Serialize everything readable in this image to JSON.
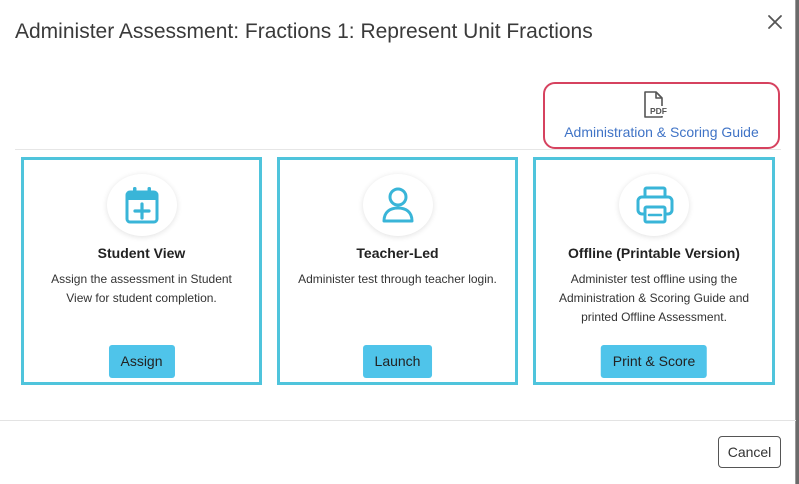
{
  "dialog": {
    "title": "Administer Assessment: Fractions 1: Represent Unit Fractions",
    "close_icon": "close-icon"
  },
  "guide": {
    "icon": "pdf-file-icon",
    "icon_text": "PDF",
    "link_label": "Administration & Scoring Guide",
    "highlight_color": "#d6425f"
  },
  "cards": [
    {
      "icon": "calendar-plus-icon",
      "title": "Student View",
      "description": "Assign the assessment in Student View for student completion.",
      "button_label": "Assign"
    },
    {
      "icon": "user-icon",
      "title": "Teacher-Led",
      "description": "Administer test through teacher login.",
      "button_label": "Launch"
    },
    {
      "icon": "printer-icon",
      "title": "Offline (Printable Version)",
      "description": "Administer test offline using the Administration & Scoring Guide and printed Offline Assessment.",
      "button_label": "Print & Score"
    }
  ],
  "footer": {
    "cancel_label": "Cancel"
  },
  "colors": {
    "accent": "#4fc4dc",
    "button": "#4fc4ea",
    "link": "#3f73c6"
  }
}
